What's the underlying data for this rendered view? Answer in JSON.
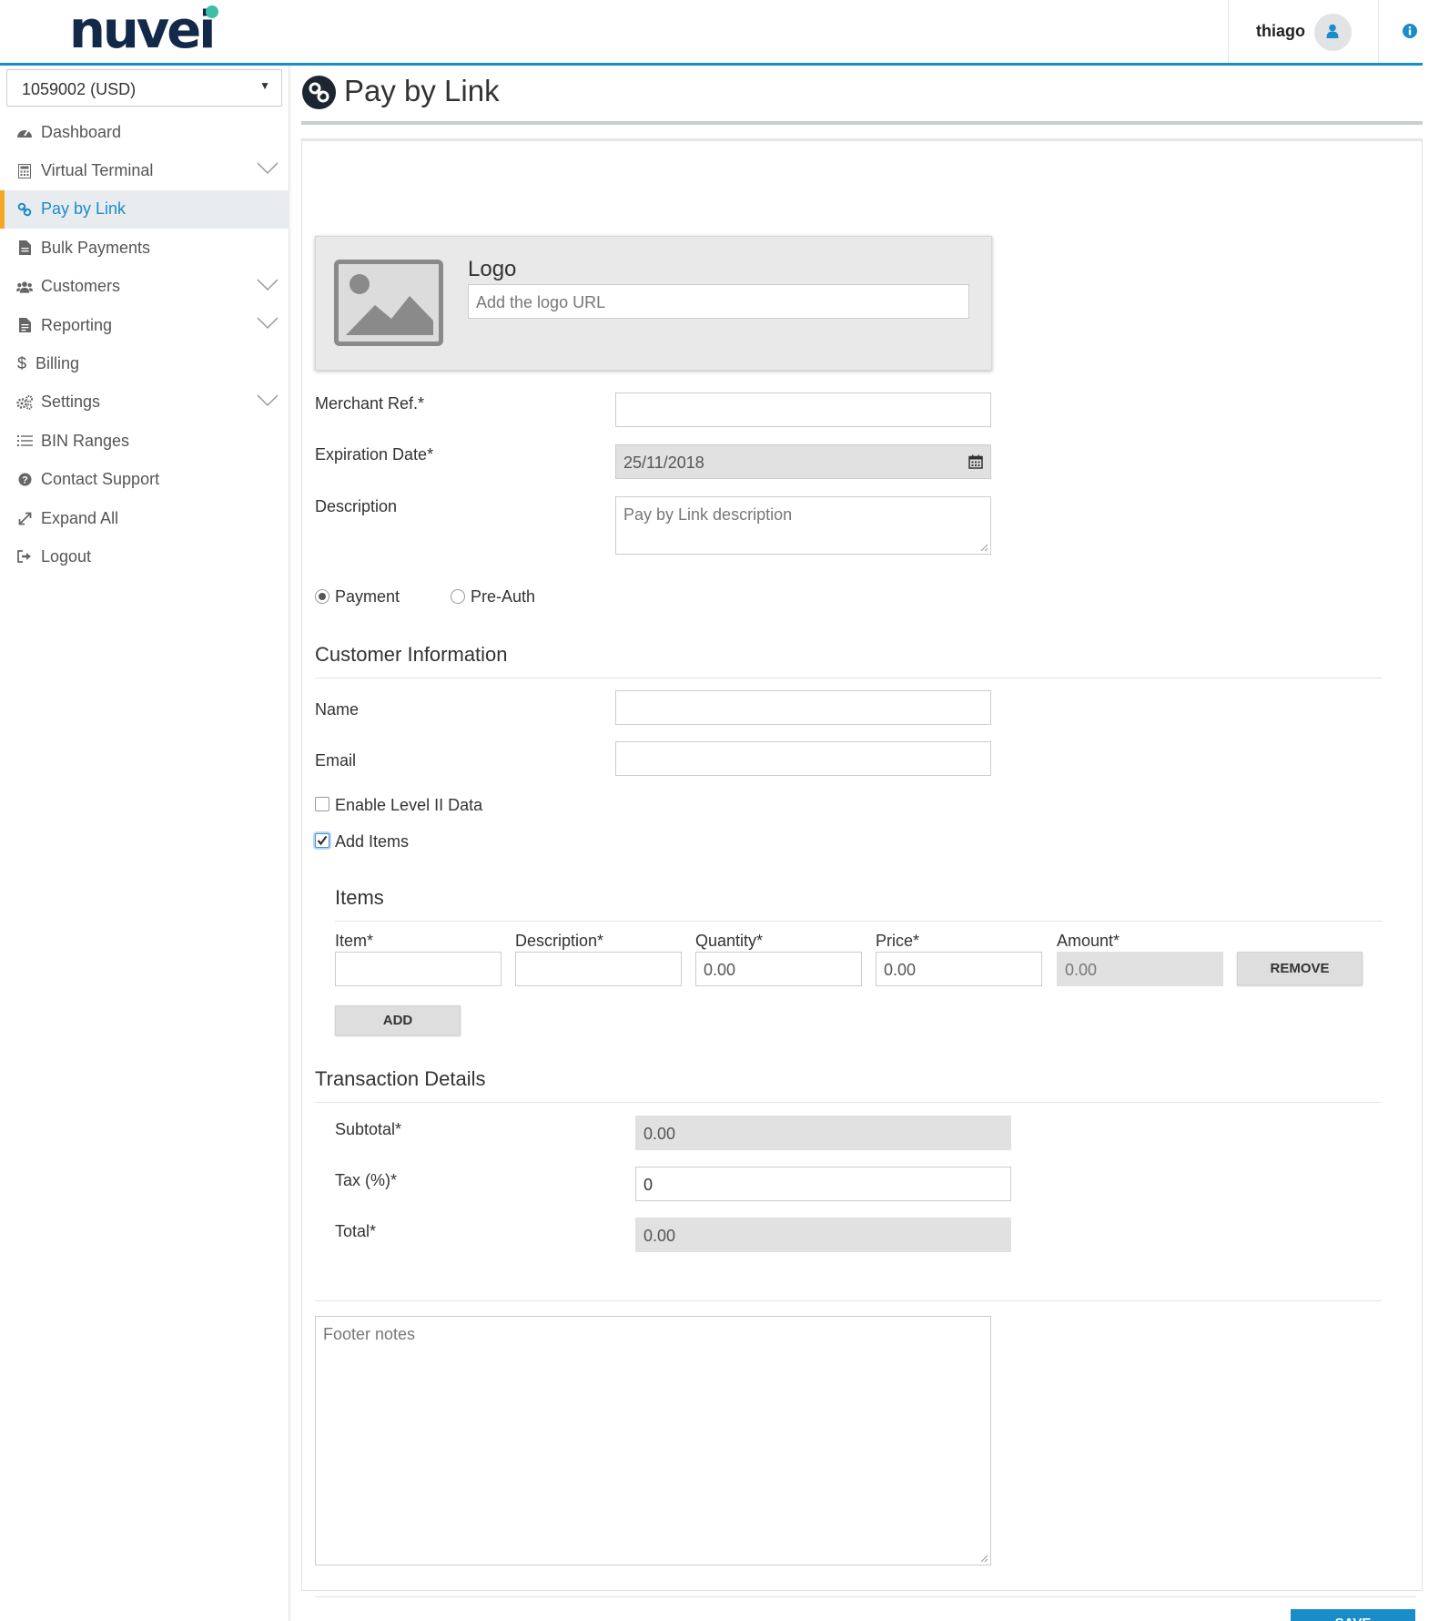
{
  "brand": {
    "name": "nuvei",
    "accent": "#1a8dc9",
    "dot": "#3cbfa6"
  },
  "header": {
    "username": "thiago"
  },
  "sidebar": {
    "account": "1059002 (USD)",
    "items": [
      {
        "label": "Dashboard",
        "icon": "dashboard-icon"
      },
      {
        "label": "Virtual Terminal",
        "icon": "calculator-icon",
        "expandable": true
      },
      {
        "label": "Pay by Link",
        "icon": "link-icon",
        "active": true
      },
      {
        "label": "Bulk Payments",
        "icon": "file-icon"
      },
      {
        "label": "Customers",
        "icon": "users-icon",
        "expandable": true
      },
      {
        "label": "Reporting",
        "icon": "report-icon",
        "expandable": true
      },
      {
        "label": "Billing",
        "icon": "dollar-icon"
      },
      {
        "label": "Settings",
        "icon": "gears-icon",
        "expandable": true
      },
      {
        "label": "BIN Ranges",
        "icon": "list-icon"
      },
      {
        "label": "Contact Support",
        "icon": "question-icon"
      },
      {
        "label": "Expand All",
        "icon": "expand-icon"
      },
      {
        "label": "Logout",
        "icon": "logout-icon"
      }
    ]
  },
  "page": {
    "title": "Pay by Link"
  },
  "form": {
    "logo_label": "Logo",
    "logo_placeholder": "Add the logo URL",
    "merchant_ref_label": "Merchant Ref.*",
    "merchant_ref_value": "",
    "expiration_label": "Expiration Date*",
    "expiration_value": "25/11/2018",
    "description_label": "Description",
    "description_placeholder": "Pay by Link description",
    "radio_payment": "Payment",
    "radio_preauth": "Pre-Auth",
    "customer_section": "Customer Information",
    "name_label": "Name",
    "email_label": "Email",
    "level2_label": "Enable Level II Data",
    "add_items_label": "Add Items"
  },
  "items": {
    "title": "Items",
    "columns": [
      "Item*",
      "Description*",
      "Quantity*",
      "Price*",
      "Amount*"
    ],
    "row": {
      "item": "",
      "description": "",
      "quantity": "0.00",
      "price": "0.00",
      "amount": "0.00"
    },
    "remove_label": "REMOVE",
    "add_label": "ADD"
  },
  "transaction": {
    "title": "Transaction Details",
    "subtotal_label": "Subtotal*",
    "subtotal_value": "0.00",
    "tax_label": "Tax (%)*",
    "tax_value": "0",
    "total_label": "Total*",
    "total_value": "0.00"
  },
  "footer": {
    "notes_placeholder": "Footer notes",
    "save_label": "SAVE"
  }
}
